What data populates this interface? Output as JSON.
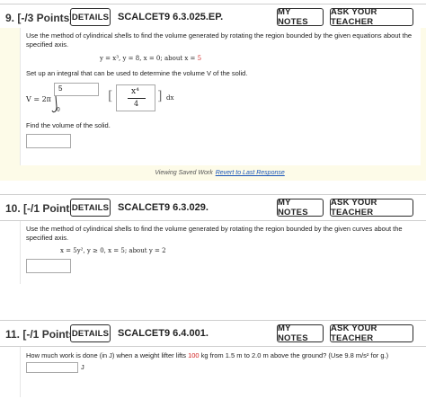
{
  "q9": {
    "points": "9.  [-/3 Points]",
    "details": "DETAILS",
    "code": "SCALCET9 6.3.025.EP.",
    "my_notes": "MY NOTES",
    "ask": "ASK YOUR TEACHER",
    "prompt": "Use the method of cylindrical shells to find the volume generated by rotating the region bounded by the given equations about the specified axis.",
    "equations": "y = x³,   y = 8,   x = 0;   about x = ",
    "about_value": "5",
    "setup": "Set up an integral that can be used to determine the volume V of the solid.",
    "v_prefix": "V = 2π",
    "upper_limit": "5",
    "lower_limit": "0",
    "frac_num": "x⁴",
    "frac_den": "4",
    "dx": "dx",
    "find": "Find the volume of the solid.",
    "saved_note": "Viewing Saved Work",
    "revert": "Revert to Last Response"
  },
  "q10": {
    "points": "10.  [-/1 Points]",
    "details": "DETAILS",
    "code": "SCALCET9 6.3.029.",
    "my_notes": "MY NOTES",
    "ask": "ASK YOUR TEACHER",
    "prompt": "Use the method of cylindrical shells to find the volume generated by rotating the region bounded by the given curves about the specified axis.",
    "equations": "x = 5y²,   y ≥ 0,   x = 5;   about y = 2"
  },
  "q11": {
    "points": "11.  [-/1 Points]",
    "details": "DETAILS",
    "code": "SCALCET9 6.4.001.",
    "my_notes": "MY NOTES",
    "ask": "ASK YOUR TEACHER",
    "prompt_a": "How much work is done (in J) when a weight lifter lifts ",
    "weight": "100",
    "prompt_b": " kg from 1.5 m to 2.0 m above the ground? (Use 9.8 m/s² for g.)",
    "unit": "J"
  },
  "colors": {
    "highlight": "#d12020",
    "link": "#1a56b8",
    "panel_bg": "#fdfbe8"
  }
}
